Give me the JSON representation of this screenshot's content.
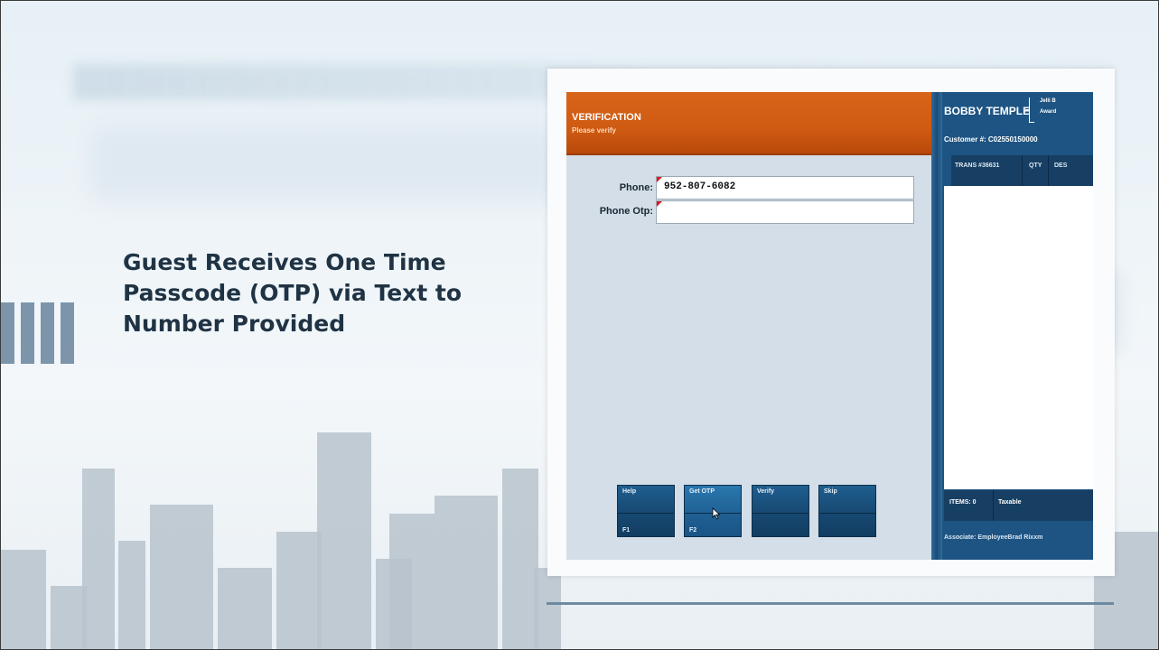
{
  "slide": {
    "headline": "Guest Receives One Time Passcode (OTP) via Text to Number Provided"
  },
  "verification": {
    "title": "VERIFICATION",
    "subtitle": "Please verify",
    "fields": [
      {
        "label": "Phone:",
        "value": "952-807-6082"
      },
      {
        "label": "Phone Otp:",
        "value": ""
      }
    ]
  },
  "function_keys": [
    {
      "label": "Help",
      "key": "F1"
    },
    {
      "label": "Get OTP",
      "key": "F2"
    },
    {
      "label": "Verify",
      "key": ""
    },
    {
      "label": "Skip",
      "key": ""
    }
  ],
  "customer_panel": {
    "name": "BOBBY TEMPLE",
    "award_line1": "Jelli B",
    "award_line2": "Award",
    "customer_number": "Customer #:  C02550150000",
    "columns": [
      "TRANS #36631",
      "QTY",
      "DES"
    ],
    "items_label": "ITEMS:  0",
    "taxable_label": "Taxable",
    "associate": "Associate:  EmployeeBrad Rixxm"
  },
  "colors": {
    "header_orange": "#d86419",
    "pos_blue": "#1c4f78",
    "accent_bar": "#7c95ab"
  },
  "icons": [
    "mouse-cursor-icon"
  ]
}
